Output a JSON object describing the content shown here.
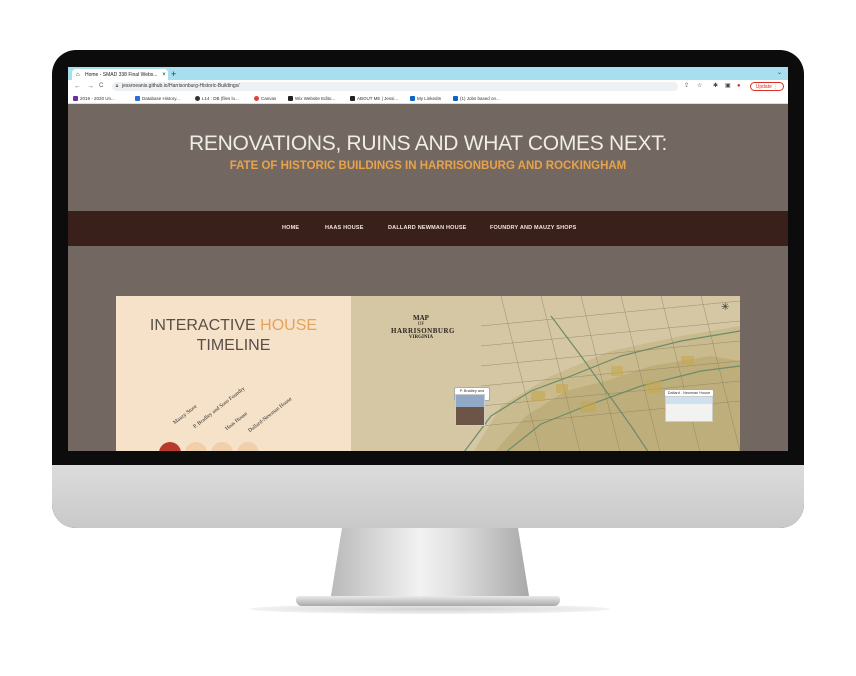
{
  "browser": {
    "tab_title": "Home - SMAD 338 Final Webs...",
    "tab_close": "×",
    "new_tab": "+",
    "tab_menu": "⌄",
    "back": "←",
    "forward": "→",
    "reload": "C",
    "url": "jessroeanis.github.io/Harrisonburg-Historic-Buildings/",
    "update_label": "Update",
    "bookmarks": [
      {
        "label": "2019 - 2020 Un...",
        "color": "#6b2fa0"
      },
      {
        "label": "Database History...",
        "color": "#2a6fd6"
      },
      {
        "label": "L14 : DB (files lo...",
        "color": "#333333"
      },
      {
        "label": "Canvas",
        "color": "#e2403a"
      },
      {
        "label": "Wix Website Edito...",
        "color": "#222222"
      },
      {
        "label": "ABOUT ME | Jessi...",
        "color": "#222222"
      },
      {
        "label": "My LinkedIn",
        "color": "#0a66c2"
      },
      {
        "label": "(1) Jobs based on...",
        "color": "#0a66c2"
      }
    ]
  },
  "site": {
    "title": "RENOVATIONS, RUINS AND WHAT COMES NEXT:",
    "subtitle": "FATE OF HISTORIC BUILDINGS IN HARRISONBURG AND ROCKINGHAM",
    "nav": [
      "HOME",
      "HAAS HOUSE",
      "DALLARD NEWMAN HOUSE",
      "FOUNDRY AND MAUZY SHOPS"
    ],
    "timeline": {
      "title_a": "INTERACTIVE ",
      "title_b": "HOUSE",
      "title_c": "TIMELINE",
      "labels": [
        "Mauzy Store",
        "P. Bradley and Sons Foundry",
        "Haas House",
        "Dallard-Newman House"
      ]
    },
    "map": {
      "title_line1": "MAP",
      "title_line2": "OF",
      "title_line3": "HARRISONBURG",
      "title_line4": "VIRGINIA",
      "pins": [
        "P. Bradley and Sons Foundry",
        "Dallard - Newman House"
      ]
    }
  },
  "colors": {
    "page_bg": "#736761",
    "nav_bg": "#3a201a",
    "accent": "#e8a34a",
    "panel_bg": "#f6e2c9",
    "tab_bar": "#a7dfee"
  }
}
